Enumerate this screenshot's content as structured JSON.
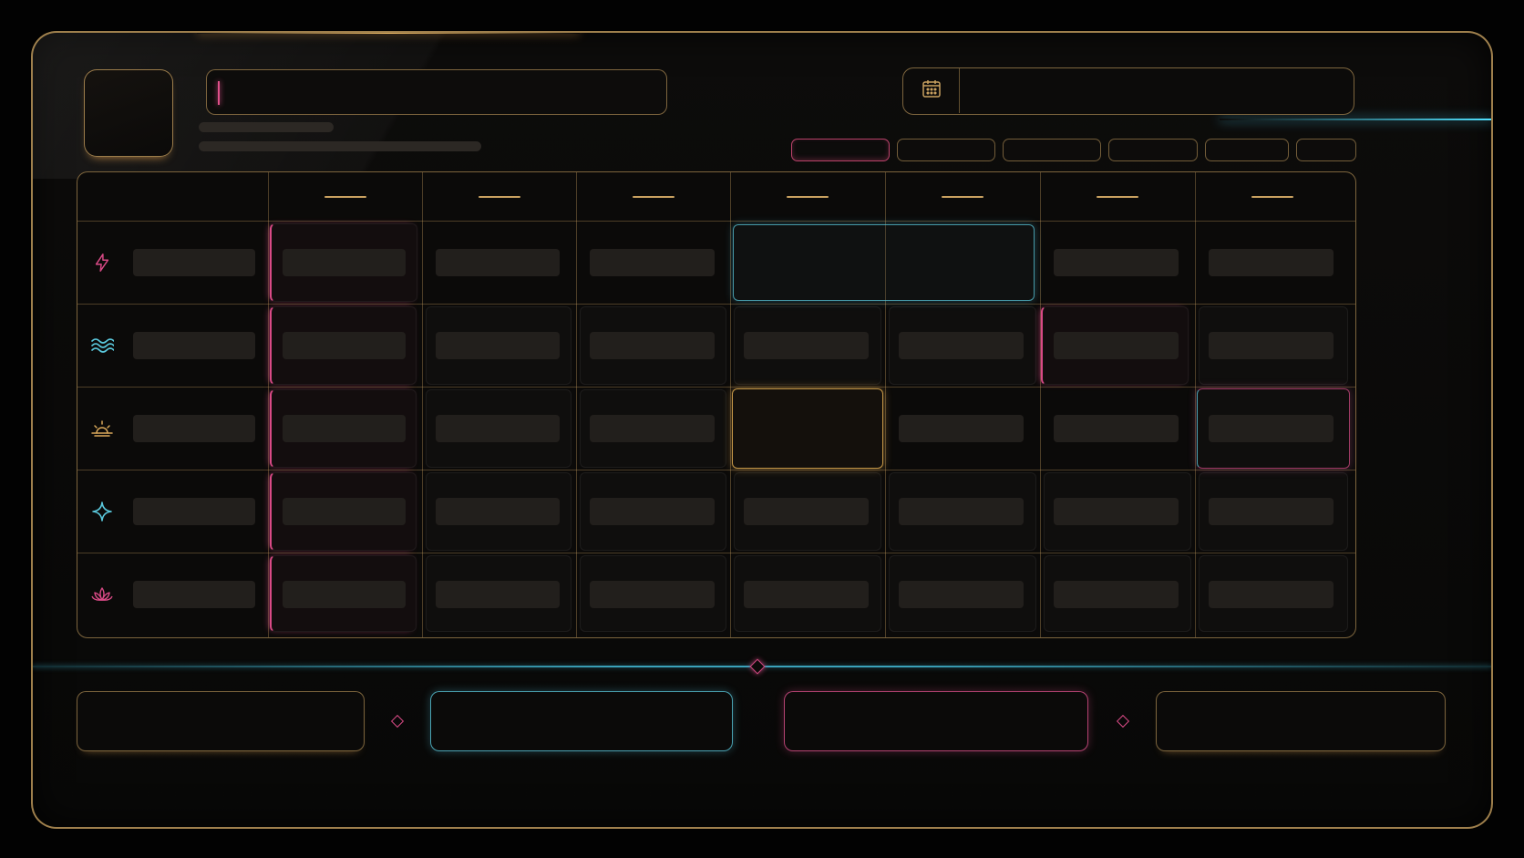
{
  "header": {
    "title_input": {
      "value": "",
      "placeholder": ""
    },
    "date_field": {
      "value": "",
      "icon": "calendar-icon"
    },
    "tabs": [
      {
        "label": "",
        "active": true
      },
      {
        "label": "",
        "active": false
      },
      {
        "label": "",
        "active": false
      },
      {
        "label": "",
        "active": false
      },
      {
        "label": "",
        "active": false
      },
      {
        "label": "",
        "active": false
      }
    ]
  },
  "schedule": {
    "day_headers": [
      "",
      "",
      "",
      "",
      "",
      "",
      ""
    ],
    "rows": [
      {
        "icon": "lightning-icon",
        "label": ""
      },
      {
        "icon": "waves-icon",
        "label": ""
      },
      {
        "icon": "sunrise-icon",
        "label": ""
      },
      {
        "icon": "sparkle-icon",
        "label": ""
      },
      {
        "icon": "lotus-icon",
        "label": ""
      }
    ]
  },
  "footer": {
    "buttons": [
      {
        "label": "",
        "accent": "gold"
      },
      {
        "label": "",
        "accent": "cyan"
      },
      {
        "label": "",
        "accent": "pink"
      },
      {
        "label": "",
        "accent": "gold"
      }
    ]
  },
  "colors": {
    "gold": "#c9a160",
    "pink": "#d94a86",
    "cyan": "#5ac8dc",
    "background": "#020202"
  }
}
